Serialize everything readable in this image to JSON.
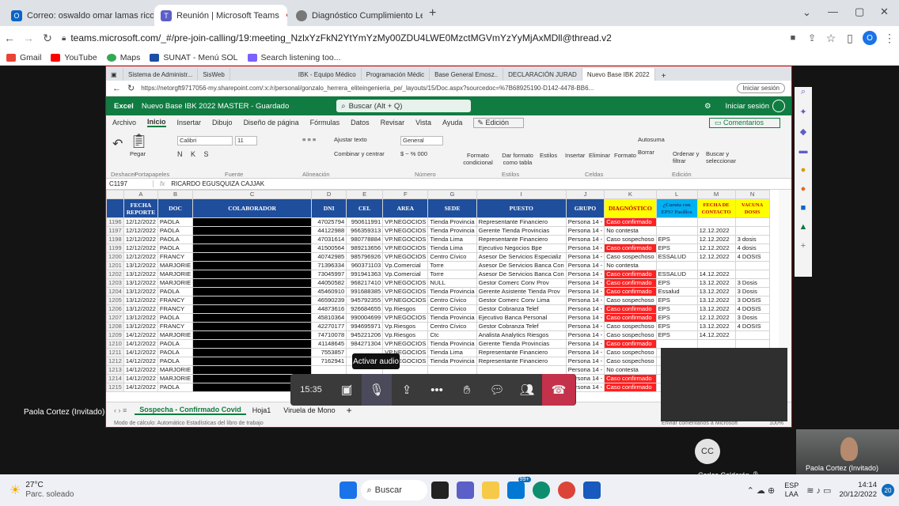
{
  "outer_tabs": [
    {
      "title": "Correo: oswaldo omar lamas rico"
    },
    {
      "title": "Reunión | Microsoft Teams"
    },
    {
      "title": "Diagnóstico Cumplimiento Ley 2"
    }
  ],
  "outer_url": "teams.microsoft.com/_#/pre-join-calling/19:meeting_NzlxYzFkN2YtYmYzMy00ZDU4LWE0MzctMGVmYzYyMjAxMDll@thread.v2",
  "bookmarks": [
    "Gmail",
    "YouTube",
    "Maps",
    "SUNAT - Menú SOL",
    "Search listening too..."
  ],
  "inner_tabs": [
    "Sistema de Administr...",
    "SisWeb",
    "IBK - Equipo Médico",
    "Programación Médic",
    "Base General Emosz..",
    "DECLARACIÓN JURAD",
    "Nuevo Base IBK 2022"
  ],
  "inner_url": "https://netorgft9717056-my.sharepoint.com/:x:/r/personal/gonzalo_herrera_eliteingenieria_pe/_layouts/15/Doc.aspx?sourcedoc=%7B68925190-D142-4478-BB6...",
  "excel": {
    "app": "Excel",
    "doc_title": "Nuevo Base IBK 2022 MASTER - Guardado",
    "search": "Buscar (Alt + Q)",
    "signin": "Iniciar sesión",
    "menus": [
      "Archivo",
      "Inicio",
      "Insertar",
      "Dibujo",
      "Diseño de página",
      "Fórmulas",
      "Datos",
      "Revisar",
      "Vista",
      "Ayuda"
    ],
    "edit_mode": "Edición",
    "comments": "Comentarios",
    "ribbon": {
      "paste": "Pegar",
      "font": "Calibri",
      "size": "11",
      "wrap": "Ajustar texto",
      "merge": "Combinar y centrar",
      "numfmt": "General",
      "cond": "Formato condicional",
      "table": "Dar formato como tabla",
      "styles": "Estilos",
      "insert": "Insertar",
      "delete": "Eliminar",
      "format": "Formato",
      "autosum": "Autosuma",
      "clear": "Borrar",
      "sort": "Ordenar y filtrar",
      "find": "Buscar y seleccionar",
      "groups": [
        "Deshacer",
        "Portapapeles",
        "Fuente",
        "Alineación",
        "Número",
        "Estilos",
        "Celdas",
        "Edición"
      ]
    },
    "namebox": "C1197",
    "formula": "RICARDO EGUSQUIZA CAJJAK",
    "col_letters": [
      "A",
      "B",
      "C",
      "D",
      "E",
      "F",
      "G",
      "I",
      "J",
      "K",
      "L",
      "M",
      "N"
    ],
    "headers": [
      "FECHA REPORTE",
      "DOC",
      "COLABORADOR",
      "DNI",
      "CEL",
      "AREA",
      "SEDE",
      "PUESTO",
      "GRUPO",
      "DIAGNÓSTICO",
      "¿Cuenta con EPS? Pacífico",
      "FECHA DE CONTACTO",
      "VACUNA DOSIS"
    ],
    "rows": [
      [
        "1196",
        "12/12/2022",
        "PAOLA",
        "47025794",
        "950611991",
        "VP.NEGOCIOS",
        "Tienda Provincia",
        "Representante Financiero",
        "Persona 14 -",
        "Caso confirmado",
        "",
        "",
        ""
      ],
      [
        "1197",
        "12/12/2022",
        "PAOLA",
        "44122988",
        "966359313",
        "VP.NEGOCIOS",
        "Tienda Provincia",
        "Gerente Tienda Provincias",
        "Persona 14 -",
        "No contesta",
        "",
        "12.12.2022",
        ""
      ],
      [
        "1198",
        "12/12/2022",
        "PAOLA",
        "47031614",
        "980778884",
        "VP.NEGOCIOS",
        "Tienda Lima",
        "Representante Financiero",
        "Persona 14 -",
        "Caso sospechoso",
        "EPS",
        "12.12.2022",
        "3 dosis"
      ],
      [
        "1199",
        "12/12/2022",
        "PAOLA",
        "41500564",
        "989213656",
        "VP.NEGOCIOS",
        "Tienda Lima",
        "Ejecutivo Negocios Bpe",
        "Persona 14 -",
        "Caso confirmado",
        "EPS",
        "12.12.2022",
        "4 dosis"
      ],
      [
        "1200",
        "12/12/2022",
        "FRANCY",
        "40742985",
        "985796926",
        "VP.NEGOCIOS",
        "Centro Cívico",
        "Asesor De Servicios Especializ",
        "Persona 14 -",
        "Caso sospechoso",
        "ESSALUD",
        "12.12.2022",
        "4 DOSIS"
      ],
      [
        "1201",
        "13/12/2022",
        "MARJORIE",
        "71396334",
        "960371103",
        "Vp.Comercial",
        "Torre",
        "Asesor De Servicios Banca Con",
        "Persona 14 -",
        "No contesta",
        "",
        "",
        ""
      ],
      [
        "1202",
        "13/12/2022",
        "MARJORIE",
        "73045997",
        "991941363",
        "Vp.Comercial",
        "Torre",
        "Asesor De Servicios Banca Con",
        "Persona 14 -",
        "Caso confirmado",
        "ESSALUD",
        "14.12.2022",
        ""
      ],
      [
        "1203",
        "13/12/2022",
        "MARJORIE",
        "44050582",
        "968217410",
        "VP.NEGOCIOS",
        "NULL",
        "Gestor Comerc Conv Prov",
        "Persona 14 -",
        "Caso confirmado",
        "EPS",
        "13.12.2022",
        "3 Dosis"
      ],
      [
        "1204",
        "13/12/2022",
        "PAOLA",
        "45460910",
        "991688385",
        "VP.NEGOCIOS",
        "Tienda Provincia",
        "Gerente Asistente Tienda Prov",
        "Persona 14 -",
        "Caso confirmado",
        "Essalud",
        "13.12.2022",
        "3 Dosis"
      ],
      [
        "1205",
        "13/12/2022",
        "FRANCY",
        "46590239",
        "945792355",
        "VP.NEGOCIOS",
        "Centro Cívico",
        "Gestor Comerc Conv Lima",
        "Persona 14 -",
        "Caso sospechoso",
        "EPS",
        "13.12.2022",
        "3 DOSIS"
      ],
      [
        "1206",
        "13/12/2022",
        "FRANCY",
        "44873616",
        "926684655",
        "Vp.Riesgos",
        "Centro Cívico",
        "Gestor Cobranza Telef",
        "Persona 14 -",
        "Caso confirmado",
        "EPS",
        "13.12.2022",
        "4 DOSIS"
      ],
      [
        "1207",
        "13/12/2022",
        "PAOLA",
        "45810364",
        "990004699",
        "VP.NEGOCIOS",
        "Tienda Provincia",
        "Ejecutivo Banca Personal",
        "Persona 14 -",
        "Caso confirmado",
        "EPS",
        "12.12.2022",
        "3 Dosis"
      ],
      [
        "1208",
        "13/12/2022",
        "FRANCY",
        "42270177",
        "994695971",
        "Vp.Riesgos",
        "Centro Cívico",
        "Gestor Cobranza Telef",
        "Persona 14 -",
        "Caso sospechoso",
        "EPS",
        "13.12.2022",
        "4 DOSIS"
      ],
      [
        "1209",
        "14/12/2022",
        "MARJORIE",
        "74710078",
        "945221206",
        "Vp.Riesgos",
        "Ctc",
        "Analista Analytics Riesgos",
        "Persona 14 -",
        "Caso sospechoso",
        "EPS",
        "14.12.2022",
        ""
      ],
      [
        "1210",
        "14/12/2022",
        "PAOLA",
        "41148645",
        "984271304",
        "VP.NEGOCIOS",
        "Tienda Provincia",
        "Gerente Tienda Provincias",
        "Persona 14 -",
        "Caso confirmado",
        "",
        "",
        ""
      ],
      [
        "1211",
        "14/12/2022",
        "PAOLA",
        "7553857",
        "",
        "VP.NEGOCIOS",
        "Tienda Lima",
        "Representante Financiero",
        "Persona 14 -",
        "Caso sospechoso",
        "",
        "",
        ""
      ],
      [
        "1212",
        "14/12/2022",
        "PAOLA",
        "7162941",
        "",
        "VP.NEGOCIOS",
        "Tienda Provincia",
        "Representante Financiero",
        "Persona 14 -",
        "Caso sospechoso",
        "",
        "",
        ""
      ],
      [
        "1213",
        "14/12/2022",
        "MARJORIE",
        "",
        "",
        "",
        "",
        "",
        "Persona 14 -",
        "No contesta",
        "",
        "",
        ""
      ],
      [
        "1214",
        "14/12/2022",
        "MARJORIE",
        "",
        "",
        "",
        "",
        "",
        "Persona 14 -",
        "Caso confirmado",
        "",
        "",
        ""
      ],
      [
        "1215",
        "14/12/2022",
        "PAOLA",
        "",
        "",
        "",
        "",
        "",
        "Persona 14 -",
        "Caso confirmado",
        "",
        "",
        ""
      ]
    ],
    "sheet_tabs": [
      "Sospecha - Confirmado Covid",
      "Hoja1",
      "Viruela de Mono"
    ],
    "status_left": "Modo de cálculo: Automático    Estadísticas del libro de trabajo",
    "status_right": "Enviar comentarios a Microsoft",
    "zoom": "100%"
  },
  "teams": {
    "presenter_label": "Paola Cortez (Invitado)",
    "participant_1": "Carlos Calderón",
    "participant_1_initials": "CC",
    "participant_2": "Paola Cortez (Invitado)",
    "call_time": "15:35",
    "tooltip": "Activar audio"
  },
  "taskbar": {
    "temp": "27°C",
    "weather": "Parc. soleado",
    "search": "Buscar",
    "lang": "ESP",
    "lang2": "LAA",
    "time": "14:14",
    "date": "20/12/2022",
    "badge": "99+",
    "notif": "20"
  }
}
